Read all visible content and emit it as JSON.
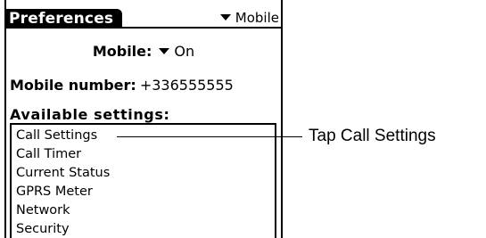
{
  "app": {
    "title": "Preferences",
    "category": "Mobile"
  },
  "mobile_setting": {
    "label": "Mobile:",
    "value": "On"
  },
  "mobile_number": {
    "label": "Mobile number:",
    "value": "+336555555"
  },
  "available_settings": {
    "label": "Available settings:",
    "items": [
      "Call Settings",
      "Call Timer",
      "Current Status",
      "GPRS Meter",
      "Network",
      "Security"
    ]
  },
  "callout": {
    "text": "Tap Call Settings"
  },
  "icons": {
    "dropdown": "dropdown-triangle-icon"
  }
}
